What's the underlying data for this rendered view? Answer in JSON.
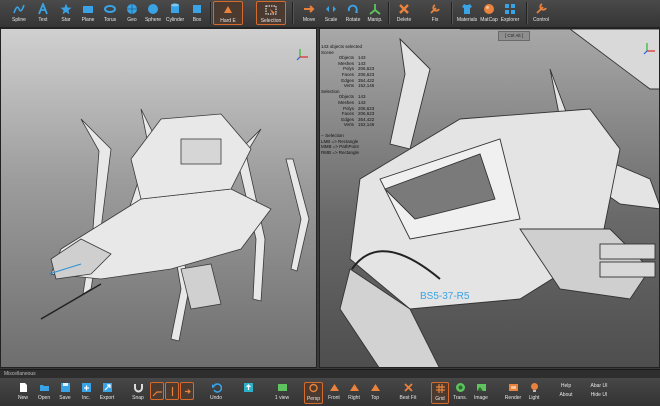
{
  "top_toolbar": {
    "spline": "Spline",
    "text": "Text",
    "star": "Star",
    "plane": "Plane",
    "torus": "Torus",
    "geo": "Geo",
    "sphere": "Sphere",
    "cylinder": "Cylinder",
    "box": "Box",
    "hard_e": "Hard E",
    "selection": "Selection",
    "move": "Move",
    "scale": "Scale",
    "rotate": "Rotate",
    "manip": "Manip.",
    "delete": "Delete",
    "fix": "Fix",
    "materials": "Materials",
    "matcap": "MatCap",
    "explorer": "Explorer",
    "control": "Control"
  },
  "viewport_right": {
    "ctrl_alt_label": "[ Ctrl Alt ]",
    "stats_title": "143 objects selected",
    "scene_label": "Scene",
    "scene": [
      {
        "k": "Objects",
        "v": "143"
      },
      {
        "k": "Meshes",
        "v": "143"
      },
      {
        "k": "Polys",
        "v": "206,623"
      },
      {
        "k": "Faces",
        "v": "206,623"
      },
      {
        "k": "Edges",
        "v": "354,422"
      },
      {
        "k": "Verts",
        "v": "152,146"
      }
    ],
    "selection_label": "Selection",
    "selection": [
      {
        "k": "Objects",
        "v": "143"
      },
      {
        "k": "Meshes",
        "v": "143"
      },
      {
        "k": "Polys",
        "v": "206,623"
      },
      {
        "k": "Faces",
        "v": "206,623"
      },
      {
        "k": "Edges",
        "v": "354,422"
      },
      {
        "k": "Verts",
        "v": "152,146"
      }
    ],
    "help_title": "-- Selection",
    "help_lines": [
      "LMB => Rectangle",
      "MMB => PathPoint",
      "RMB => Rectangle"
    ]
  },
  "misc_bar": {
    "label": "Miscellaneous"
  },
  "bottom_toolbar": {
    "new": "New",
    "open": "Open",
    "save": "Save",
    "inc": "Inc.",
    "export": "Export",
    "snap": "Snap",
    "undo": "Undo",
    "one_view": "1 view",
    "persp": "Persp",
    "front": "Front",
    "right": "Right",
    "top": "Top",
    "best_fit": "Best Fit",
    "grid": "Grid",
    "trans": "Trans.",
    "image": "Image",
    "render": "Render",
    "light": "Light",
    "help": "Help",
    "about": "About",
    "abar_ui": "Abar UI",
    "hide_ui": "Hide UI"
  },
  "colors": {
    "accent_orange": "#d66a2c",
    "icon_blue": "#3aa3e6",
    "toolbar_bg": "#3a3a3a"
  }
}
